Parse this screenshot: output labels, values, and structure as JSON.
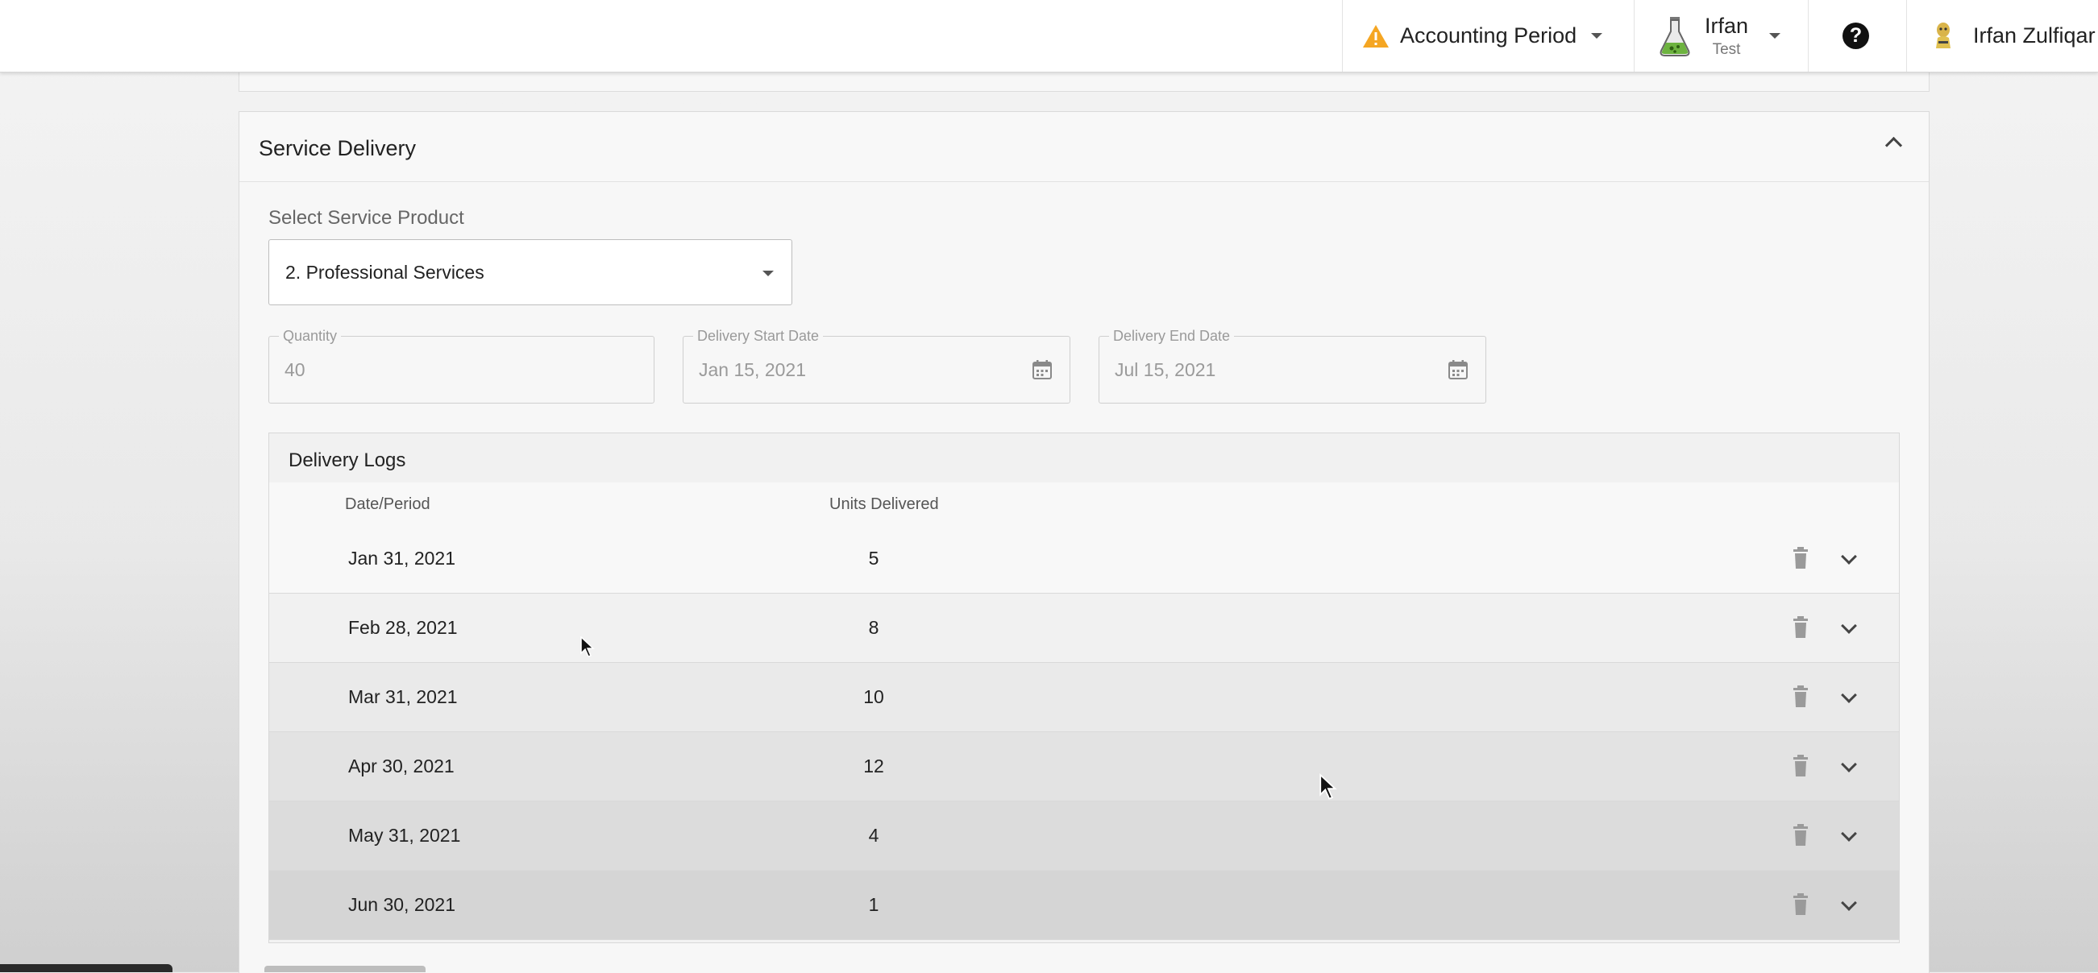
{
  "header": {
    "accounting_period": "Accounting Period",
    "org_name": "Irfan",
    "org_env": "Test",
    "help": "?",
    "user_name": "Irfan Zulfiqar"
  },
  "service_delivery": {
    "title": "Service Delivery",
    "select_label": "Select Service Product",
    "selected_product": "2. Professional Services",
    "quantity": {
      "label": "Quantity",
      "value": "40"
    },
    "start_date": {
      "label": "Delivery Start Date",
      "value": "Jan 15, 2021"
    },
    "end_date": {
      "label": "Delivery End Date",
      "value": "Jul 15, 2021"
    }
  },
  "delivery_logs": {
    "title": "Delivery Logs",
    "columns": [
      "Date/Period",
      "Units Delivered"
    ],
    "rows": [
      {
        "date": "Jan 31, 2021",
        "units": "5"
      },
      {
        "date": "Feb 28, 2021",
        "units": "8"
      },
      {
        "date": "Mar 31, 2021",
        "units": "10"
      },
      {
        "date": "Apr 30, 2021",
        "units": "12"
      },
      {
        "date": "May 31, 2021",
        "units": "4"
      },
      {
        "date": "Jun 30, 2021",
        "units": "1"
      }
    ]
  },
  "colors": {
    "warning": "#f5a623",
    "flask_liquid": "#6db33f",
    "accent_dark": "#222222"
  },
  "icons": [
    "warning-icon",
    "flask-icon",
    "help-icon",
    "avatar-icon",
    "calendar-icon",
    "trash-icon",
    "chevron-down-icon",
    "chevron-up-icon"
  ]
}
